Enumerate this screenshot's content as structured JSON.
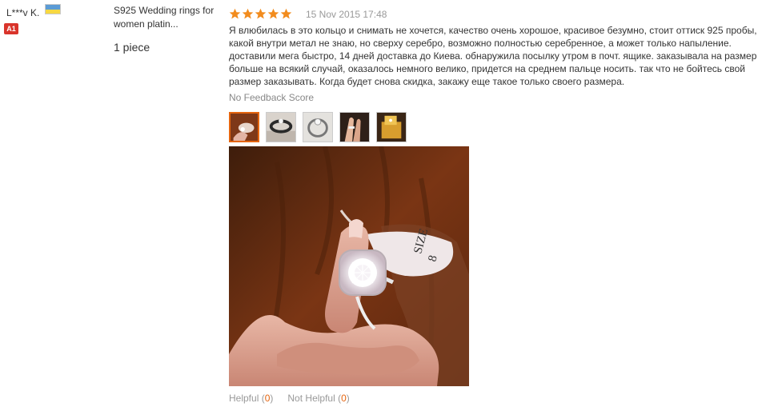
{
  "reviewer": {
    "name": "L***v K.",
    "flag_colors": [
      "#5b9bd5",
      "#f7d842"
    ],
    "level_badge": "A1"
  },
  "product": {
    "name": "S925 Wedding rings for women platin...",
    "quantity": "1 piece"
  },
  "review": {
    "rating": 5,
    "rating_max": 5,
    "star_color": "#f28c1e",
    "date": "15 Nov 2015 17:48",
    "text": "Я влюбилась в это кольцо и снимать не хочется, качество очень хорошое, красивое безумно, стоит оттиск 925 пробы, какой внутри метал не знаю, но сверху серебро, возможно полностью серебренное, а может только напыление. доставили мега быстро, 14 дней доставка до Киева. обнаружила посылку утром в почт. ящике. заказывала на размер больше на всякий случай, оказалось немного велико, придется на среднем пальце носить. так что не бойтесь свой размер заказывать. Когда будет снова скидка, закажу еще такое только своего размера.",
    "feedback_score": "No Feedback Score",
    "photo_count": 5,
    "selected_photo": 1,
    "tag_text": "SIZE",
    "tag_number": "8"
  },
  "votes": {
    "helpful_label": "Helpful",
    "helpful_count": "0",
    "not_helpful_label": "Not Helpful",
    "not_helpful_count": "0",
    "count_color": "#e5650f"
  }
}
